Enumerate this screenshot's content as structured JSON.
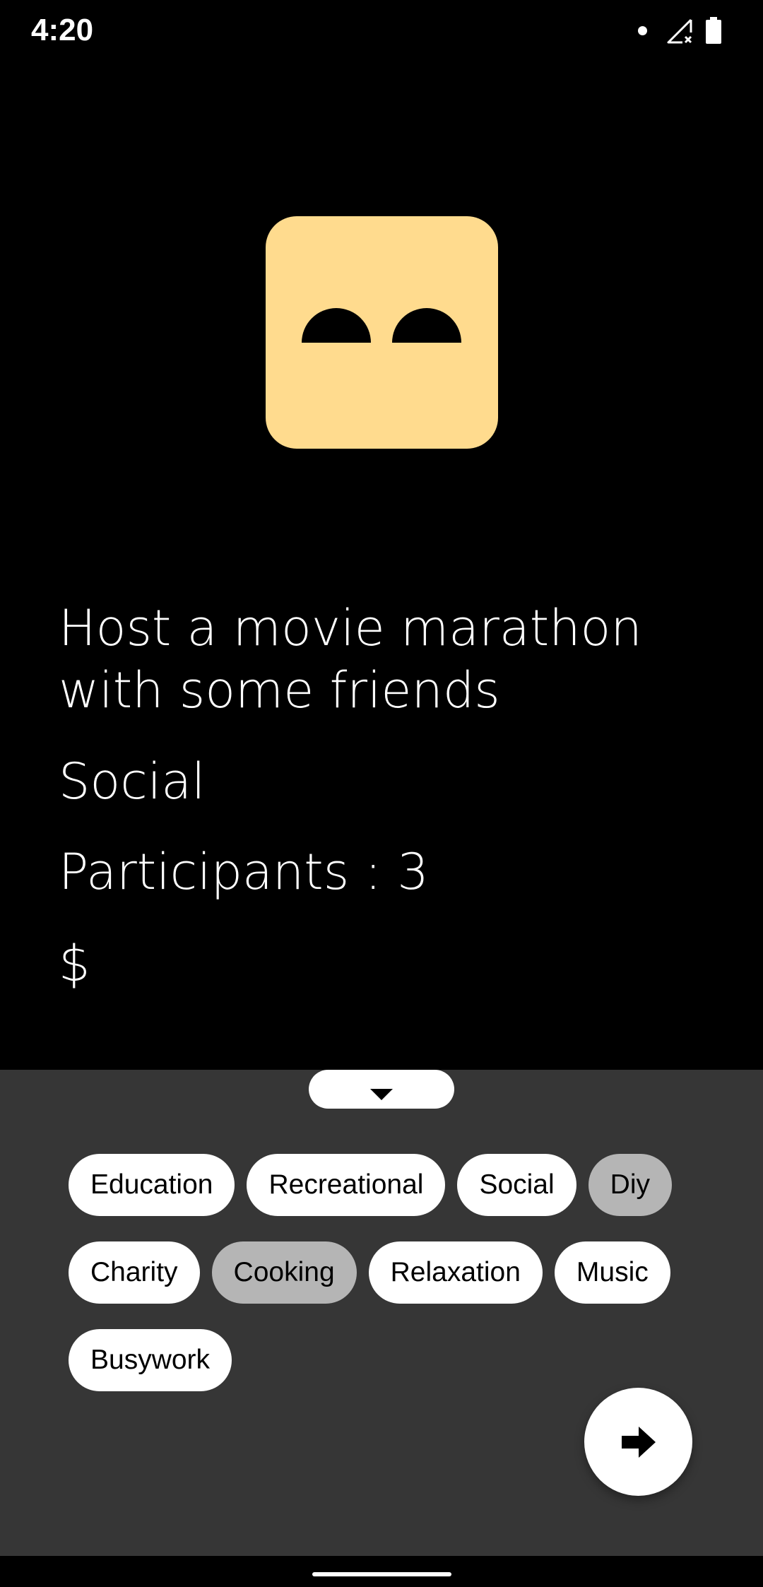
{
  "status_bar": {
    "time": "4:20",
    "icons": [
      "notification-dot-icon",
      "no-signal-icon",
      "battery-icon"
    ]
  },
  "mascot": {
    "icon": "face-icon",
    "color": "#ffdb8e"
  },
  "activity": {
    "title": "Host a movie marathon with some friends",
    "type": "Social",
    "participants": "Participants : 3",
    "price": "$"
  },
  "sheet": {
    "handle_icon": "chevron-down-icon",
    "background": "#363636",
    "chips": [
      {
        "label": "Education",
        "selected": false
      },
      {
        "label": "Recreational",
        "selected": false
      },
      {
        "label": "Social",
        "selected": false
      },
      {
        "label": "Diy",
        "selected": true
      },
      {
        "label": "Charity",
        "selected": false
      },
      {
        "label": "Cooking",
        "selected": true
      },
      {
        "label": "Relaxation",
        "selected": false
      },
      {
        "label": "Music",
        "selected": false
      },
      {
        "label": "Busywork",
        "selected": false
      }
    ],
    "fab_icon": "arrow-right-icon"
  }
}
